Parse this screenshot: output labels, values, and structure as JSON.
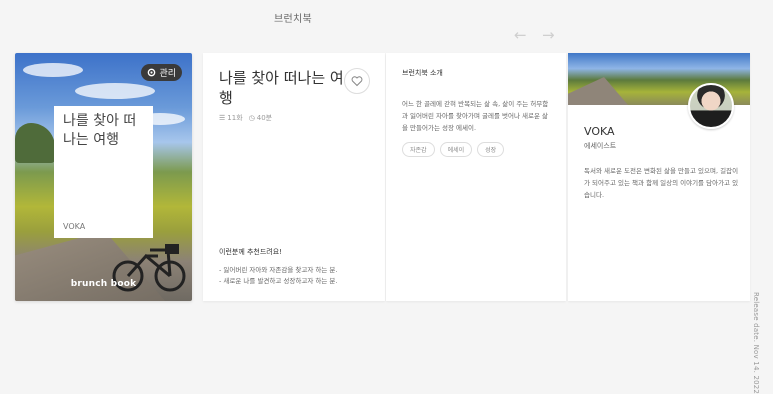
{
  "header": {
    "title": "브런치북"
  },
  "nav": {
    "prev_icon": "arrow-left-icon",
    "next_icon": "arrow-right-icon"
  },
  "cover": {
    "manage_label": "관리",
    "title": "나를 찾아 떠나는 여행",
    "author": "VOKA",
    "brand": "brunch book"
  },
  "book_info": {
    "title": "나를 찾아 떠나는 여행",
    "episodes": "11화",
    "read_time": "40분",
    "recommend_title": "이런분께 추천드려요!",
    "recommend_items": [
      "- 잃어버린 자아와 자존감을 찾고자 하는 분.",
      "- 새로운 나를 발견하고 성장하고자 하는 분."
    ]
  },
  "intro": {
    "heading": "브런치북 소개",
    "text": "어느 한 골레에 갇혀 반복되는 삶 속, 삶이 주는 허무함과 잃어버린 자아를 찾아가며 굴레를 벗어나 새로운 삶을 만들어가는 성장 에세이.",
    "tags": [
      "자존감",
      "에세이",
      "성장"
    ]
  },
  "author": {
    "name": "VOKA",
    "job": "에세이스트",
    "bio": "독서와 새로운 도전은 변화된 삶을 만들고 있으며, 길잡이가 되어주고 있는 책과 함께 일상의 이야기를 담아가고 있습니다."
  },
  "release_date": "Release date. Nov 14. 2022",
  "colors": {
    "background": "#f5f5f5",
    "manage_bg": "#3a3a3a"
  }
}
